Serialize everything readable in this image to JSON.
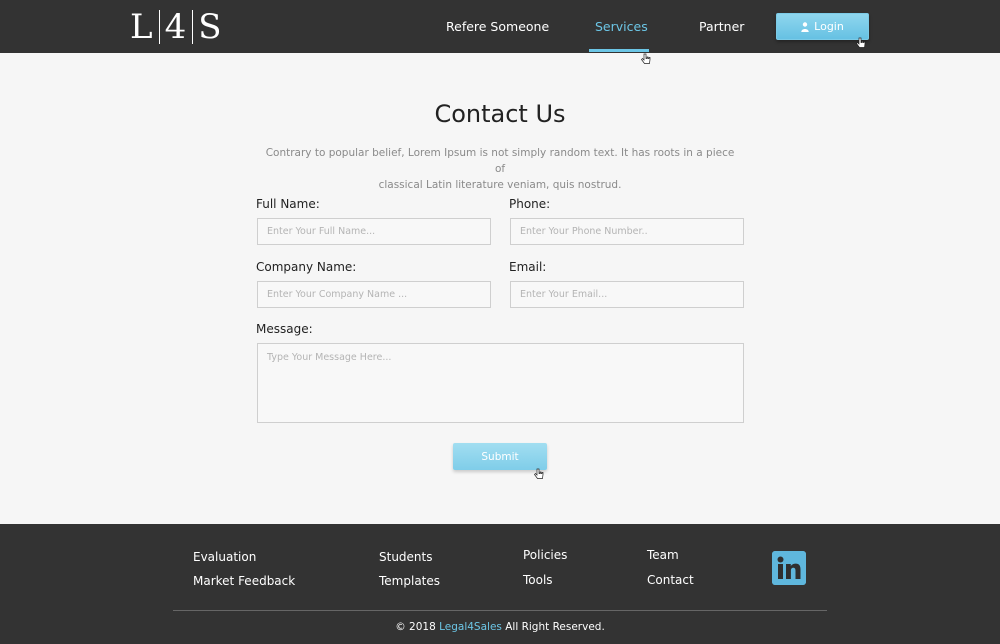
{
  "header": {
    "logo_left": "L",
    "logo_mid": "4",
    "logo_right": "S",
    "nav": {
      "refer": "Refere Someone",
      "services": "Services",
      "partner": "Partner"
    },
    "login_label": "Login",
    "accent_color": "#6cc6e6"
  },
  "main": {
    "title": "Contact Us",
    "intro_line1": "Contrary to popular belief, Lorem Ipsum is not simply random text. It has roots in a piece of",
    "intro_line2": "classical Latin literature veniam, quis nostrud.",
    "form": {
      "full_name_label": "Full Name:",
      "full_name_placeholder": "Enter Your Full Name...",
      "phone_label": "Phone:",
      "phone_placeholder": "Enter Your Phone Number..",
      "company_label": "Company Name:",
      "company_placeholder": "Enter Your Company Name ...",
      "email_label": "Email:",
      "email_placeholder": "Enter Your Email...",
      "message_label": "Message:",
      "message_placeholder": "Type Your Message Here...",
      "submit_label": "Submit"
    }
  },
  "footer": {
    "links": {
      "evaluation": "Evaluation",
      "market_feedback": "Market Feedback",
      "students": "Students",
      "templates": "Templates",
      "policies": "Policies",
      "tools": "Tools",
      "team": "Team",
      "contact": "Contact"
    },
    "social_icon": "linkedin-icon",
    "copyright_prefix": "© 2018 ",
    "copyright_brand": "Legal4Sales",
    "copyright_suffix": " All Right Reserved."
  }
}
